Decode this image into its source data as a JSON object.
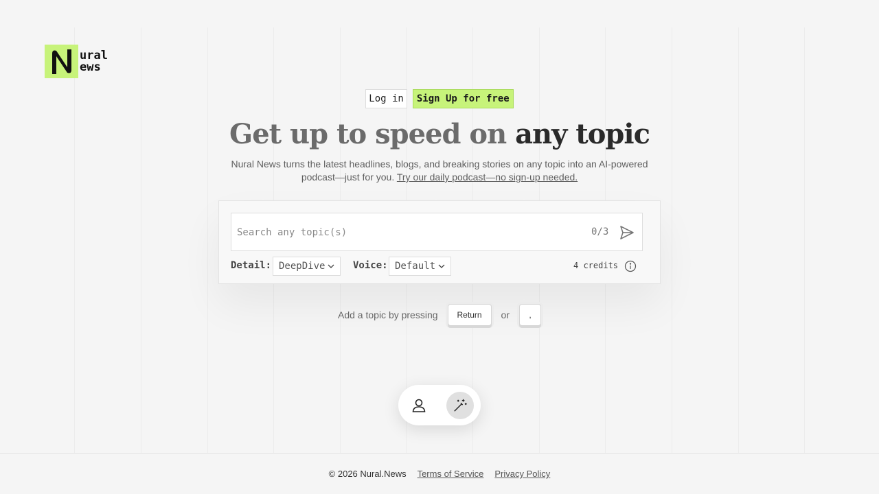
{
  "brand": {
    "line1": "ural",
    "line2": "ews",
    "accent": "#c7f37a",
    "icon": "nural-news-logo"
  },
  "auth": {
    "login_label": "Log in",
    "signup_label": "Sign Up for free"
  },
  "hero": {
    "headline_light": "Get up to speed on",
    "headline_bold": "any topic",
    "subtitle": "Nural News turns the latest headlines, blogs, and breaking stories on any topic into an AI-powered podcast—just for you.",
    "subtitle_link": "Try our daily podcast—no sign-up needed."
  },
  "search": {
    "placeholder": "Search any topic(s)",
    "value": "",
    "counter": "0/3",
    "send_icon": "send-icon"
  },
  "controls": {
    "detail_label": "Detail:",
    "detail_value": "DeepDive",
    "voice_label": "Voice:",
    "voice_value": "Default",
    "credits": "4 credits",
    "info_icon": "info-icon"
  },
  "hint": {
    "text": "Add a topic by pressing",
    "key_return": "Return",
    "or": "or",
    "key_comma": ","
  },
  "dock": {
    "user_icon": "user-icon",
    "magic_icon": "magic-wand-icon"
  },
  "footer": {
    "copyright": "© 2026 Nural.News",
    "terms": "Terms of Service",
    "privacy": "Privacy Policy"
  }
}
